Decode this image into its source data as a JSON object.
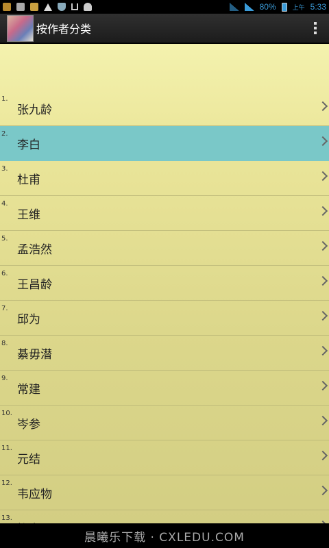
{
  "statusbar": {
    "battery": "80%",
    "ampm": "上午",
    "time": "5:33"
  },
  "actionbar": {
    "title": "按作者分类"
  },
  "list": {
    "items": [
      {
        "num": "1.",
        "label": "张九龄",
        "selected": false
      },
      {
        "num": "2.",
        "label": "李白",
        "selected": true
      },
      {
        "num": "3.",
        "label": "杜甫",
        "selected": false
      },
      {
        "num": "4.",
        "label": "王维",
        "selected": false
      },
      {
        "num": "5.",
        "label": "孟浩然",
        "selected": false
      },
      {
        "num": "6.",
        "label": "王昌龄",
        "selected": false
      },
      {
        "num": "7.",
        "label": "邱为",
        "selected": false
      },
      {
        "num": "8.",
        "label": "綦毋潜",
        "selected": false
      },
      {
        "num": "9.",
        "label": "常建",
        "selected": false
      },
      {
        "num": "10.",
        "label": "岑参",
        "selected": false
      },
      {
        "num": "11.",
        "label": "元结",
        "selected": false
      },
      {
        "num": "12.",
        "label": "韦应物",
        "selected": false
      },
      {
        "num": "13.",
        "label": "柳宗元",
        "selected": false
      }
    ]
  },
  "navbar": {
    "watermark": "晨曦乐下载 · CXLEDU.COM"
  }
}
